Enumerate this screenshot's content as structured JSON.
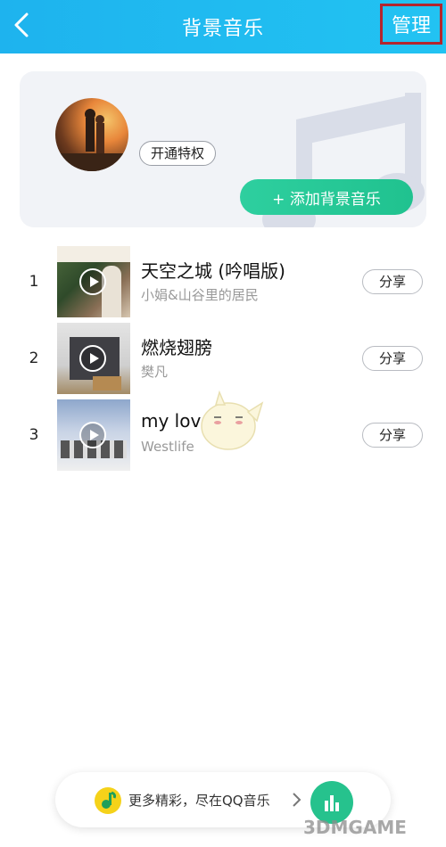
{
  "header": {
    "title": "背景音乐",
    "manage_label": "管理"
  },
  "card": {
    "vip_label": "开通特权",
    "add_label": "+ 添加背景音乐"
  },
  "songs": [
    {
      "index": "1",
      "title": "天空之城 (吟唱版)",
      "artist": "小娟&山谷里的居民",
      "share": "分享"
    },
    {
      "index": "2",
      "title": "燃烧翅膀",
      "artist": "樊凡",
      "share": "分享"
    },
    {
      "index": "3",
      "title": "my love",
      "artist": "Westlife",
      "share": "分享"
    }
  ],
  "banner": {
    "text": "更多精彩，尽在QQ音乐"
  },
  "watermark": "3DMGAME",
  "icons": {
    "back": "chevron-left-icon",
    "music_note": "music-note-icon",
    "play": "play-icon",
    "equalizer": "equalizer-icon",
    "qq_music_logo": "qq-music-logo"
  },
  "colors": {
    "header": "#1eb3ee",
    "accent_green": "#20c28f",
    "manage_border": "#b3262e"
  }
}
